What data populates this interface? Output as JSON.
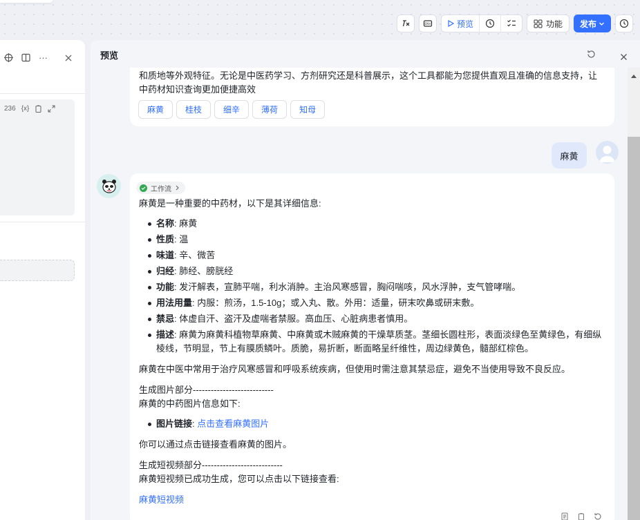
{
  "toolbar": {
    "preview_label": "预览",
    "function_label": "功能",
    "publish_label": "发布"
  },
  "left_panel": {
    "code_count": "236",
    "var_label": "{x}"
  },
  "preview": {
    "title": "预览"
  },
  "top_message": {
    "text": "和质地等外观特征。无论是中医药学习、方剂研究还是科普展示，这个工具都能为您提供直观且准确的信息支持，让中药材知识查询更加便捷高效",
    "chips": [
      "麻黄",
      "桂枝",
      "细辛",
      "薄荷",
      "知母"
    ]
  },
  "user_message": {
    "text": "麻黄"
  },
  "bot_message": {
    "workflow_label": "工作流",
    "intro": "麻黄是一种重要的中药材，以下是其详细信息:",
    "items": [
      {
        "key": "名称",
        "value": ": 麻黄"
      },
      {
        "key": "性质",
        "value": ": 温"
      },
      {
        "key": "味道",
        "value": ": 辛、微苦"
      },
      {
        "key": "归经",
        "value": ": 肺经、膀胱经"
      },
      {
        "key": "功能",
        "value": ": 发汗解表，宣肺平喘，利水消肿。主治风寒感冒，胸闷喘咳，风水浮肿，支气管哮喘。"
      },
      {
        "key": "用法用量",
        "value": ": 内服：煎汤，1.5-10g；或入丸、散。外用：适量，研末吹鼻或研末敷。"
      },
      {
        "key": "禁忌",
        "value": ": 体虚自汗、盗汗及虚喘者禁服。高血压、心脏病患者慎用。"
      },
      {
        "key": "描述",
        "value": ": 麻黄为麻黄科植物草麻黄、中麻黄或木贼麻黄的干燥草质茎。茎细长圆柱形，表面淡绿色至黄绿色，有细纵棱线，节明显，节上有膜质鳞叶。质脆，易折断，断面略呈纤维性，周边绿黄色，髓部红棕色。"
      }
    ],
    "summary": "麻黄在中医中常用于治疗风寒感冒和呼吸系统疾病，但使用时需注意其禁忌症，避免不当使用导致不良反应。",
    "image_section_header": "生成图片部分---------------------------",
    "image_section_intro": "麻黄的中药图片信息如下:",
    "image_link_key": "图片链接",
    "image_link_sep": ": ",
    "image_link_text": "点击查看麻黄图片",
    "image_note": "你可以通过点击链接查看麻黄的图片。",
    "video_section_header": "生成短视频部分---------------------------",
    "video_section_intro": "麻黄短视频已成功生成，您可以点击以下链接查看:",
    "video_link_text": "麻黄短视频"
  },
  "colors": {
    "accent": "#3370ff",
    "user_bubble": "#dfe9fb",
    "success": "#34a853"
  }
}
